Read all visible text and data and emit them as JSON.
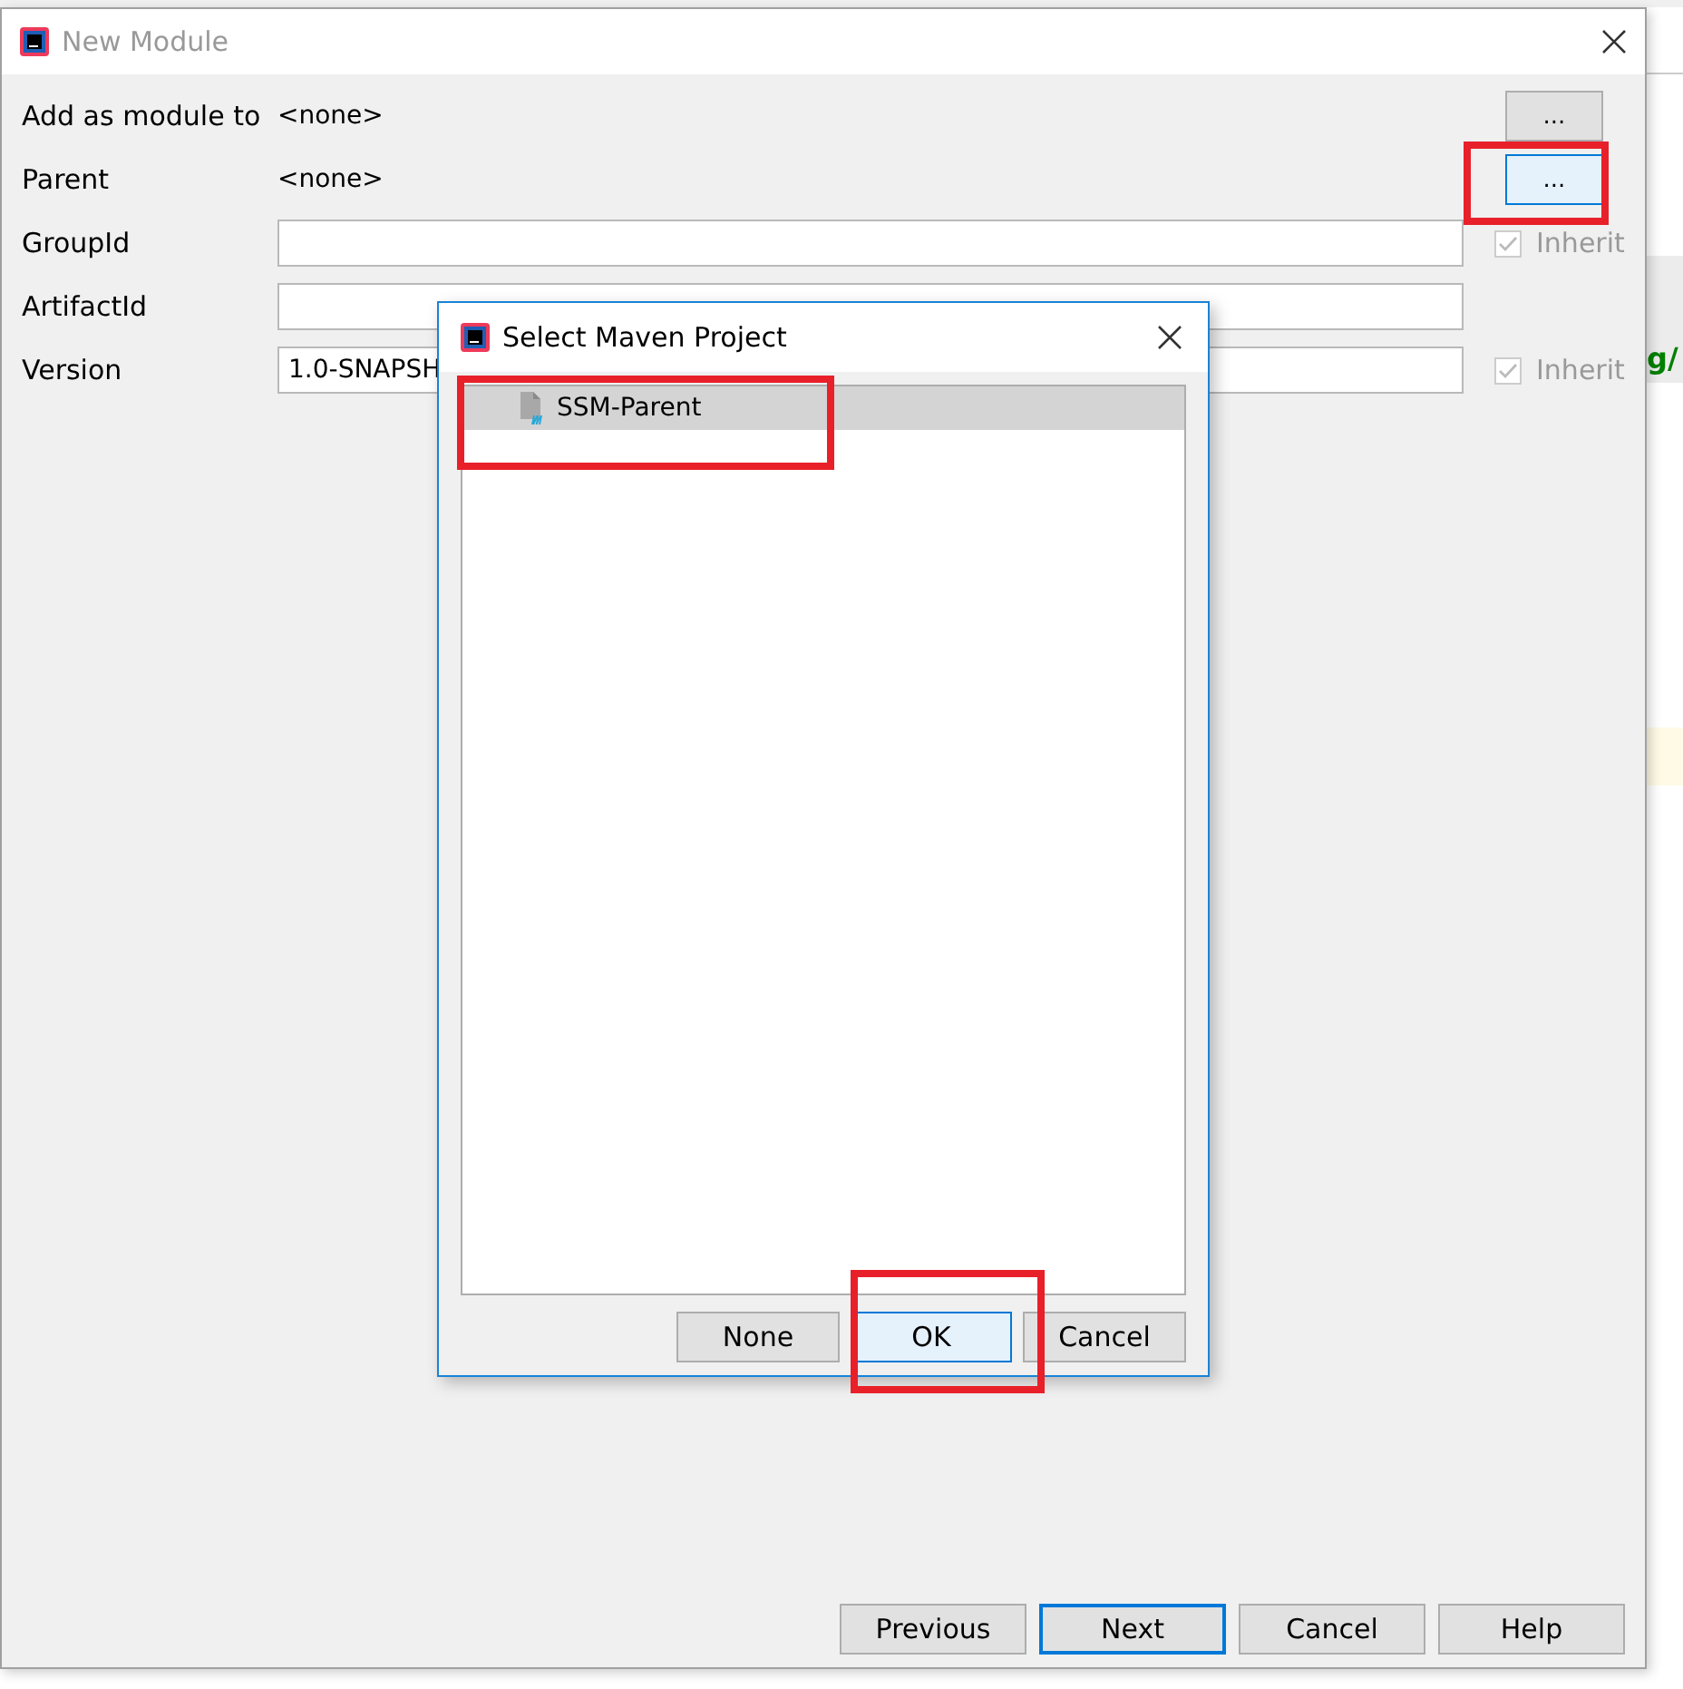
{
  "window": {
    "title": "New Module"
  },
  "rows": [
    {
      "kind": "text",
      "label": "Add as module to",
      "value": "<none>",
      "button": "...",
      "button_highlighted": false
    },
    {
      "kind": "text",
      "label": "Parent",
      "value": "<none>",
      "button": "...",
      "button_highlighted": true
    },
    {
      "kind": "field",
      "label": "GroupId",
      "value": "",
      "inherit": {
        "label": "Inherit",
        "checked": true
      }
    },
    {
      "kind": "field",
      "label": "ArtifactId",
      "value": ""
    },
    {
      "kind": "field",
      "label": "Version",
      "value": "1.0-SNAPSH",
      "inherit": {
        "label": "Inherit",
        "checked": true
      }
    }
  ],
  "buttons": [
    {
      "label": "Previous",
      "default": false
    },
    {
      "label": "Next",
      "default": true
    },
    {
      "label": "Cancel",
      "default": false
    },
    {
      "label": "Help",
      "default": false
    }
  ],
  "background_code": "g/",
  "dialog": {
    "title": "Select Maven Project",
    "items": [
      {
        "label": "SSM-Parent",
        "selected": true,
        "highlighted": true
      }
    ],
    "buttons": [
      {
        "label": "None",
        "default": false,
        "highlighted": false
      },
      {
        "label": "OK",
        "default": true,
        "highlighted": true
      },
      {
        "label": "Cancel",
        "default": false,
        "highlighted": false
      }
    ]
  }
}
